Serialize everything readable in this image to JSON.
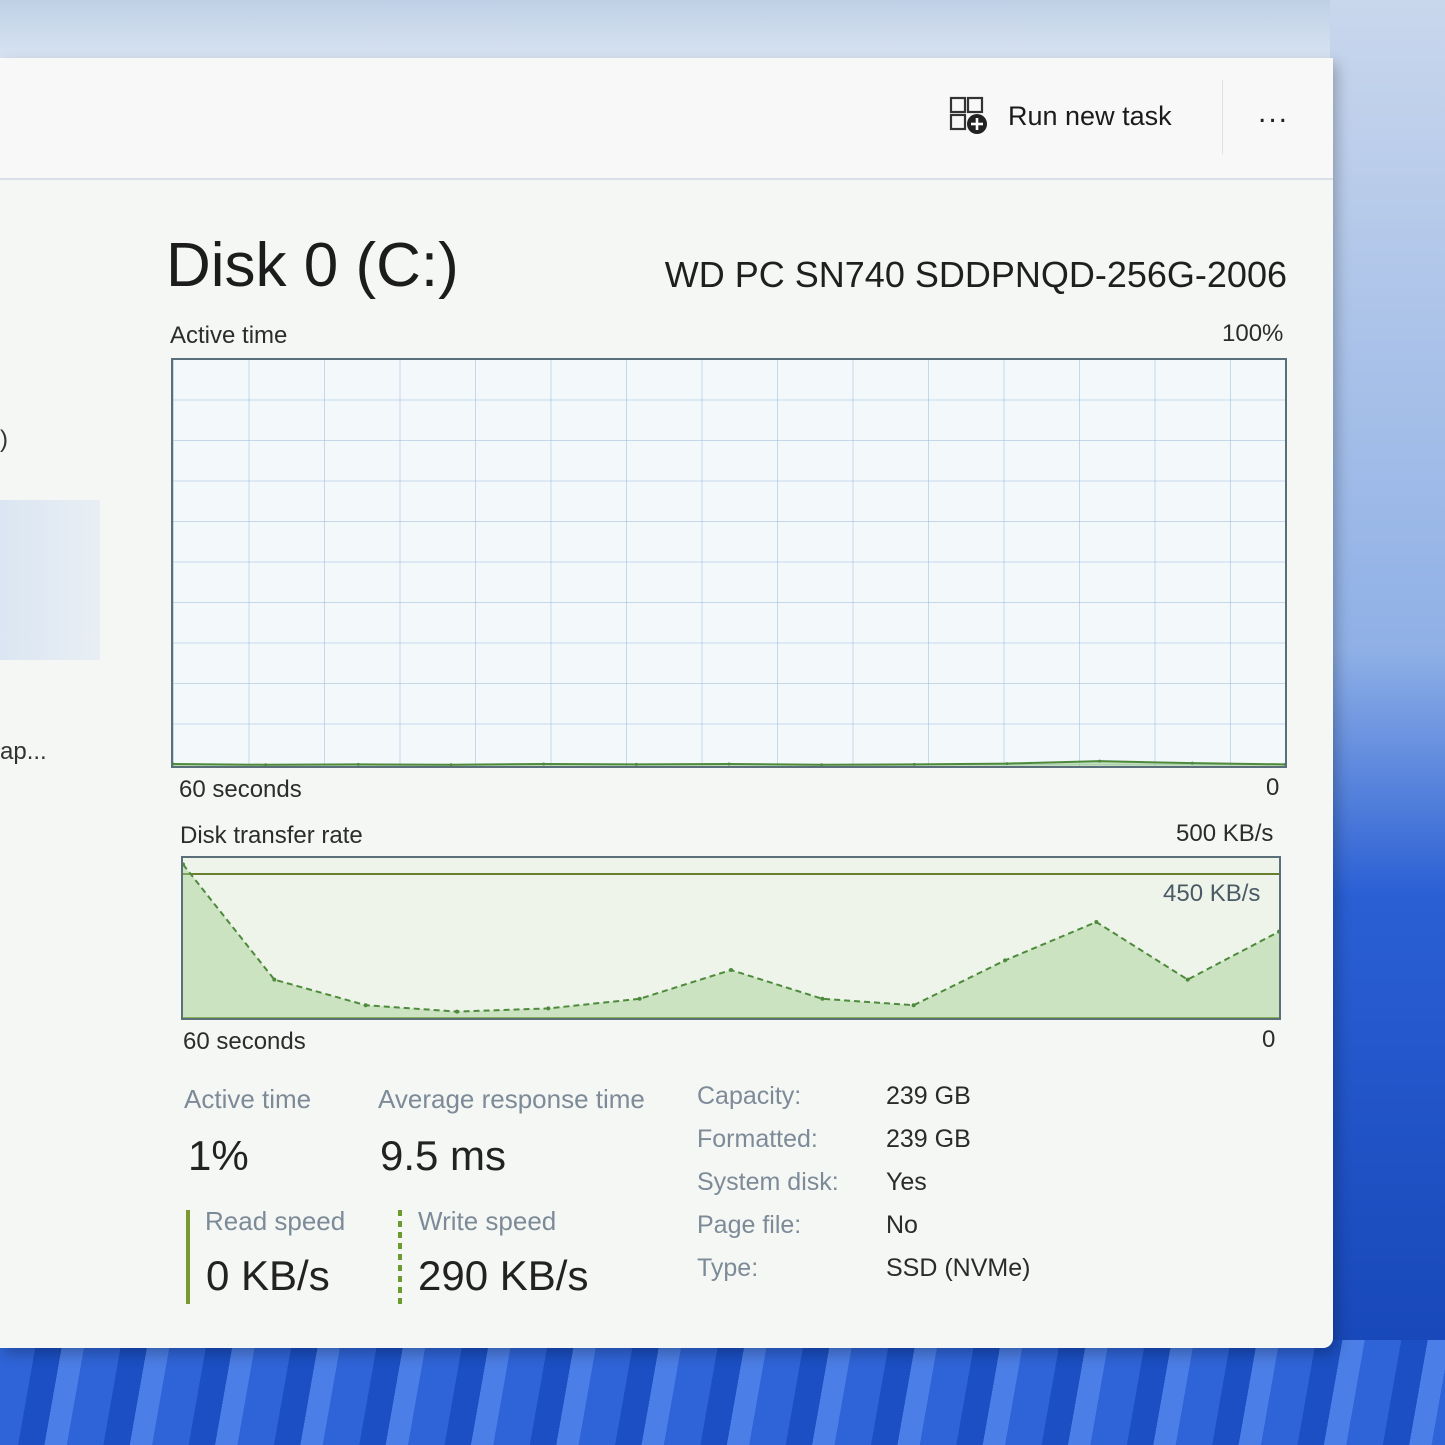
{
  "toolbar": {
    "run_new_task_label": "Run new task",
    "more_label": "..."
  },
  "sidebar": {
    "fragment_paren": ")",
    "fragment_text": "ap..."
  },
  "disk": {
    "title": "Disk 0 (C:)",
    "model": "WD PC SN740 SDDPNQD-256G-2006"
  },
  "active_graph": {
    "label": "Active time",
    "max_label": "100%",
    "time_label": "60 seconds",
    "min_label": "0"
  },
  "transfer_graph": {
    "label": "Disk transfer rate",
    "max_label": "500 KB/s",
    "line_label": "450 KB/s",
    "time_label": "60 seconds",
    "min_label": "0"
  },
  "stats": {
    "active_time_label": "Active time",
    "active_time_value": "1%",
    "avg_response_label": "Average response time",
    "avg_response_value": "9.5 ms",
    "read_speed_label": "Read speed",
    "read_speed_value": "0 KB/s",
    "write_speed_label": "Write speed",
    "write_speed_value": "290 KB/s"
  },
  "properties": [
    {
      "key": "Capacity:",
      "value": "239 GB"
    },
    {
      "key": "Formatted:",
      "value": "239 GB"
    },
    {
      "key": "System disk:",
      "value": "Yes"
    },
    {
      "key": "Page file:",
      "value": "No"
    },
    {
      "key": "Type:",
      "value": "SSD (NVMe)"
    }
  ],
  "chart_data": [
    {
      "type": "area",
      "title": "Active time",
      "ylim": [
        0,
        100
      ],
      "x": [
        60,
        55,
        50,
        45,
        40,
        35,
        30,
        25,
        20,
        15,
        10,
        5,
        0
      ],
      "series": [
        {
          "values": [
            0.5,
            0.3,
            0.4,
            0.3,
            0.5,
            0.4,
            0.5,
            0.3,
            0.4,
            0.6,
            1.2,
            0.7,
            0.4
          ]
        }
      ]
    },
    {
      "type": "line",
      "title": "Disk transfer rate",
      "ylim": [
        0,
        500
      ],
      "x": [
        60,
        55,
        50,
        45,
        40,
        35,
        30,
        25,
        20,
        15,
        10,
        5,
        0
      ],
      "series": [
        {
          "name": "Read speed",
          "values": [
            0,
            0,
            0,
            0,
            0,
            0,
            0,
            0,
            0,
            0,
            0,
            0,
            0
          ]
        },
        {
          "name": "Write speed",
          "values": [
            480,
            120,
            40,
            20,
            30,
            60,
            150,
            60,
            40,
            180,
            300,
            120,
            270
          ]
        }
      ]
    }
  ],
  "colors": {
    "graph_line": "#4e8a3c",
    "graph_fill": "#9fcf8f",
    "read_bar": "#7a9a2e",
    "write_bar": "#6b9a2e",
    "title_text": "#1c1c1c",
    "muted_text": "#7d8a98"
  },
  "icons": {
    "run_new_task": "run-new-task-icon",
    "more": "more-options-icon"
  }
}
